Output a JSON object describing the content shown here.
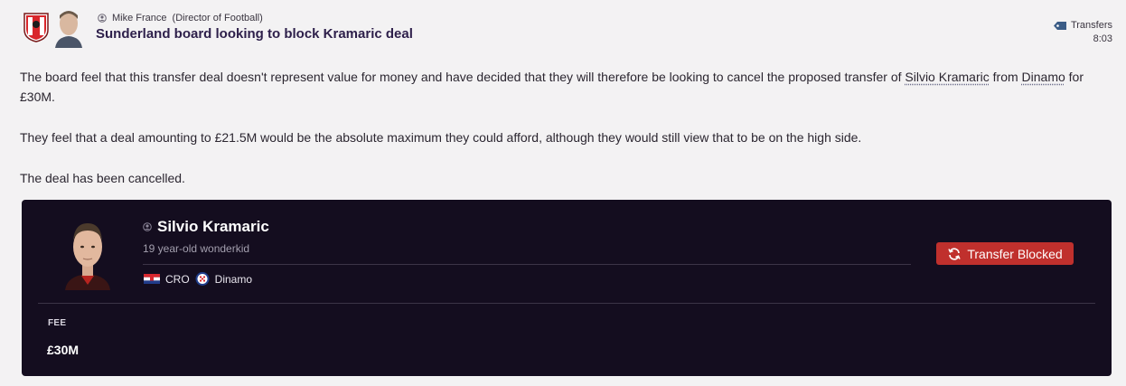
{
  "header": {
    "sender": "Mike France",
    "sender_role": "(Director of Football)",
    "subject": "Sunderland board looking to block Kramaric deal",
    "category": "Transfers",
    "time": "8:03"
  },
  "message": {
    "p1_a": "The board feel that this transfer deal doesn't represent value for money and have decided that they will therefore be looking to cancel the proposed transfer of ",
    "player_link": "Silvio Kramaric",
    "p1_b": " from ",
    "club_link": "Dinamo",
    "p1_c": " for £30M.",
    "p2": "They feel that a deal amounting to £21.5M would be the absolute maximum they could afford, although they would still view that to be on the high side.",
    "p3": "The deal has been cancelled."
  },
  "card": {
    "player_name": "Silvio Kramaric",
    "description": "19 year-old wonderkid",
    "nationality": "CRO",
    "club": "Dinamo",
    "status_label": "Transfer Blocked",
    "fee_label": "FEE",
    "fee_value": "£30M"
  },
  "colors": {
    "page_bg": "#f3f2f3",
    "card_bg": "#140d1f",
    "status_red": "#c0302d",
    "subject_text": "#2d1f4a"
  },
  "icons": {
    "club_badge": "sunderland-badge-icon",
    "sender_photo": "staff-face-icon",
    "person": "person-icon",
    "category": "tag-icon",
    "player_photo": "player-face-icon",
    "flag": "croatia-flag-icon",
    "crest": "dinamo-crest-icon",
    "status": "refresh-icon"
  }
}
